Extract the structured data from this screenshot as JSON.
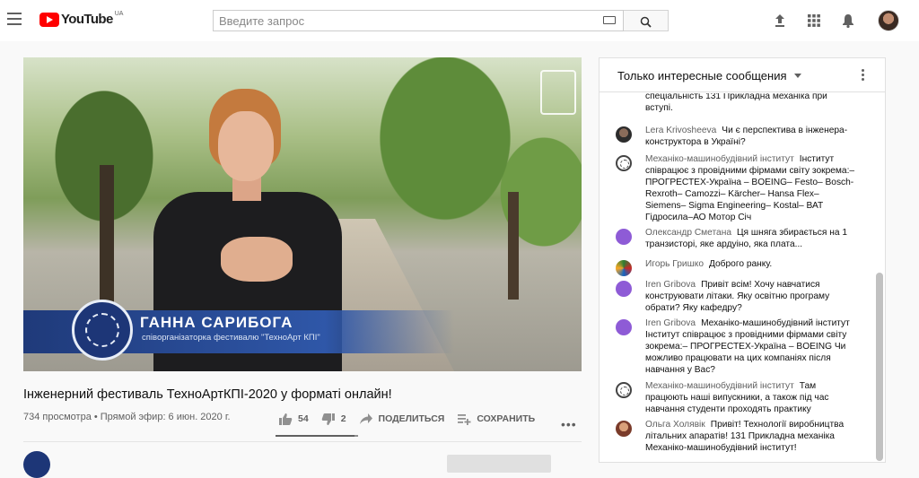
{
  "header": {
    "logo_text": "YouTube",
    "country_code": "UA",
    "search_placeholder": "Введите запрос"
  },
  "player": {
    "lower_third_name": "ГАННА САРИБОГА",
    "lower_third_role": "співорганізаторка фестивалю \"ТехноАрт КПІ\""
  },
  "video": {
    "title": "Інженерний фестиваль ТехноАртКПІ-2020 у форматі онлайн!",
    "meta": "734 просмотра • Прямой эфир: 6 июн. 2020 г.",
    "likes": "54",
    "dislikes": "2",
    "share_label": "ПОДЕЛИТЬСЯ",
    "save_label": "СОХРАНИТЬ",
    "like_ratio": 0.96
  },
  "chat": {
    "mode_label": "Только интересные сообщения",
    "messages": [
      {
        "author": "",
        "text": "спеціальність 131 Прикладна механіка при вступі."
      },
      {
        "author": "Lera Krivosheeva",
        "text": "Чи є перспектива в інженера-конструктора в Україні?"
      },
      {
        "author": "Механіко-машинобудівний інститут",
        "text": "Інститут співрацює з провідними фірмами світу зокрема:– ПРОГРЕСТЕХ-Україна – BOEING– Festo– Bosch-Rexroth– Camozzi– Kärcher– Hansa Flex– Siemens– Sigma Engineering– Kostal– ВАТ Гідросила–АО Мотор Січ"
      },
      {
        "author": "Олександр Сметана",
        "text": "Ця шняга збирається на 1 транзисторі, яке ардуіно, яка плата..."
      },
      {
        "author": "Игорь Гришко",
        "text": "Доброго ранку."
      },
      {
        "author": "Iren Gribova",
        "text": "Привіт всім! Хочу навчатися конструювати літаки. Яку освітню програму обрати? Яку кафедру?"
      },
      {
        "author": "Iren Gribova",
        "text": "Механіко-машинобудівний інститут Інститут співрацює з провідними фірмами світу зокрема:– ПРОГРЕСТЕХ-Україна – BOEING Чи можливо працювати на цих компаніях після навчання у Вас?"
      },
      {
        "author": "Механіко-машинобудівний інститут",
        "text": "Там працюють наші випускники, а також під час навчання студенти проходять практику"
      },
      {
        "author": "Ольга Холявік",
        "text": "Привіт! Технології виробництва літальних апаратів! 131 Прикладна механіка Механіко-машинобудівний інститут!"
      }
    ]
  }
}
